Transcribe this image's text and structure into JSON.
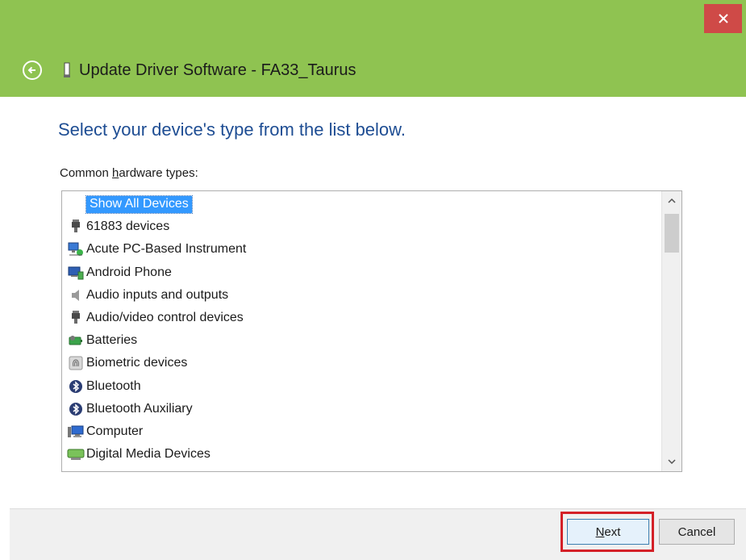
{
  "window": {
    "title": "Update Driver Software - FA33_Taurus",
    "close_label": "×",
    "accent": "#8fc351"
  },
  "page": {
    "heading": "Select your device's type from the list below.",
    "list_label_pre": "Common ",
    "list_label_acc": "h",
    "list_label_post": "ardware types:"
  },
  "hardware_list": {
    "items": [
      {
        "label": "Show All Devices",
        "icon": "none",
        "selected": true
      },
      {
        "label": "61883 devices",
        "icon": "connector-icon"
      },
      {
        "label": "Acute PC-Based Instrument",
        "icon": "network-pc-icon"
      },
      {
        "label": "Android Phone",
        "icon": "phone-computer-icon"
      },
      {
        "label": "Audio inputs and outputs",
        "icon": "speaker-icon"
      },
      {
        "label": "Audio/video control devices",
        "icon": "connector-icon"
      },
      {
        "label": "Batteries",
        "icon": "battery-icon"
      },
      {
        "label": "Biometric devices",
        "icon": "fingerprint-icon"
      },
      {
        "label": "Bluetooth",
        "icon": "bluetooth-icon"
      },
      {
        "label": "Bluetooth Auxiliary",
        "icon": "bluetooth-icon"
      },
      {
        "label": "Computer",
        "icon": "computer-icon"
      },
      {
        "label": "Digital Media Devices",
        "icon": "media-device-icon"
      }
    ]
  },
  "buttons": {
    "next_acc": "N",
    "next_rest": "ext",
    "cancel": "Cancel"
  }
}
